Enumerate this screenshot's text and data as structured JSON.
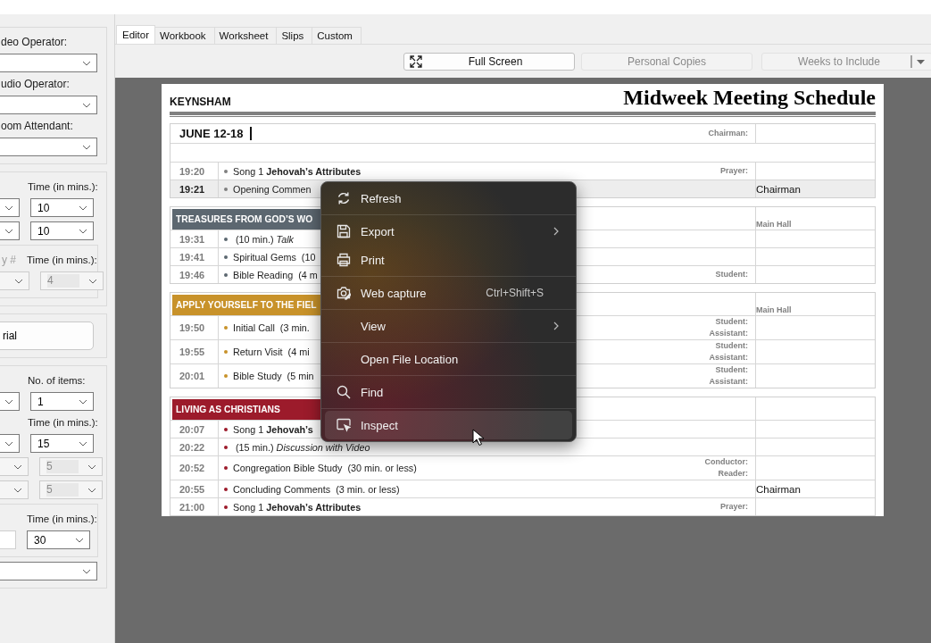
{
  "tabs": [
    {
      "label": "Editor",
      "selected": true
    },
    {
      "label": "Workbook",
      "selected": false
    },
    {
      "label": "Worksheet",
      "selected": false
    },
    {
      "label": "Slips",
      "selected": false
    },
    {
      "label": "Custom",
      "selected": false
    }
  ],
  "toolbar": [
    {
      "label": "Full Screen",
      "kind": "fullscreen",
      "disabled": false
    },
    {
      "label": "Personal Copies",
      "kind": "plain",
      "disabled": true
    },
    {
      "label": "Weeks to Include",
      "kind": "dropdown",
      "disabled": true
    }
  ],
  "side_panel": {
    "groups": [
      {
        "rows": [
          {
            "full": {
              "kind": "label",
              "text": "deo Operator:"
            }
          },
          {
            "full": {
              "kind": "combo",
              "disabled": false
            }
          },
          {
            "full": {
              "kind": "label",
              "text": "udio Operator:"
            }
          },
          {
            "full": {
              "kind": "combo",
              "disabled": false
            }
          },
          {
            "full": {
              "kind": "label",
              "text": "oom Attendant:"
            }
          },
          {
            "full": {
              "kind": "combo",
              "disabled": false
            }
          }
        ]
      },
      {
        "rows": [
          {
            "right": {
              "kind": "label",
              "text": "Time (in mins.):"
            }
          },
          {
            "left": {
              "kind": "combo",
              "disabled": false
            },
            "right": {
              "kind": "combo",
              "value": "10",
              "disabled": false
            }
          },
          {
            "left": {
              "kind": "combo",
              "disabled": false
            },
            "right": {
              "kind": "combo",
              "value": "10",
              "disabled": false
            }
          },
          {
            "kind": "subgroup",
            "rows": [
              {
                "left": {
                  "kind": "label",
                  "text": "y #",
                  "disabled": true
                },
                "right": {
                  "kind": "label",
                  "text": "Time (in mins.):"
                }
              },
              {
                "left": {
                  "kind": "combo",
                  "disabled": true
                },
                "right": {
                  "kind": "combo",
                  "value": "4",
                  "disabled": true
                }
              }
            ]
          }
        ]
      },
      {
        "rows": [
          {
            "full": {
              "kind": "button",
              "text": "rial"
            }
          }
        ]
      },
      {
        "rows": [
          {
            "right": {
              "kind": "label",
              "text": "No. of items:"
            }
          },
          {
            "left": {
              "kind": "combo",
              "disabled": false
            },
            "right": {
              "kind": "combo",
              "value": "1",
              "disabled": false
            }
          },
          {
            "right": {
              "kind": "label",
              "text": "Time (in mins.):"
            }
          },
          {
            "left": {
              "kind": "combo",
              "disabled": false
            },
            "right": {
              "kind": "combo",
              "value": "15",
              "disabled": false
            }
          },
          {
            "left": {
              "kind": "combo",
              "disabled": true
            },
            "right": {
              "kind": "combo",
              "value": "5",
              "disabled": true
            }
          },
          {
            "left": {
              "kind": "combo",
              "disabled": true
            },
            "right": {
              "kind": "combo",
              "value": "5",
              "disabled": true
            }
          },
          {
            "kind": "subgroup",
            "rows": [
              {
                "right": {
                  "kind": "label",
                  "text": "Time (in mins.):"
                }
              },
              {
                "left": {
                  "kind": "input"
                },
                "right": {
                  "kind": "combo",
                  "value": "30",
                  "disabled": false
                }
              }
            ]
          },
          {
            "full": {
              "kind": "combo",
              "disabled": false
            }
          }
        ]
      }
    ]
  },
  "document": {
    "congregation": "KEYNSHAM",
    "title": "Midweek Meeting Schedule",
    "blocks": [
      {
        "color": "#808080",
        "rows": [
          {
            "kind": "week",
            "text": "JUNE 12-18",
            "roles": [
              "Chairman:"
            ]
          },
          {
            "kind": "blank"
          },
          {
            "kind": "item",
            "time": "19:20",
            "text": "Song 1 **Jehovah’s Attributes**",
            "roles": [
              "Prayer:"
            ],
            "selected": false
          },
          {
            "kind": "item",
            "time": "19:21",
            "text": "Opening Commen",
            "assignee": "Chairman",
            "selected": true
          }
        ]
      },
      {
        "color": "#5c6770",
        "header": {
          "title": "TREASURES FROM GOD’S WO",
          "hall": "Main Hall"
        },
        "rows": [
          {
            "kind": "item",
            "time": "19:31",
            "text": " (10 min.) *Talk*",
            "selected": false
          },
          {
            "kind": "item",
            "time": "19:41",
            "text": "Spiritual Gems  (10",
            "selected": false
          },
          {
            "kind": "item",
            "time": "19:46",
            "text": "Bible Reading  (4 m",
            "roles": [
              "Student:"
            ],
            "selected": false
          }
        ]
      },
      {
        "color": "#c8922a",
        "header": {
          "title": "APPLY YOURSELF TO THE FIEL",
          "hall": "Main Hall"
        },
        "rows": [
          {
            "kind": "item",
            "time": "19:50",
            "text": "Initial Call  (3 min.",
            "roles": [
              "Student:",
              "Assistant:"
            ],
            "selected": false
          },
          {
            "kind": "item",
            "time": "19:55",
            "text": "Return Visit  (4 mi",
            "roles": [
              "Student:",
              "Assistant:"
            ],
            "selected": false
          },
          {
            "kind": "item",
            "time": "20:01",
            "text": "Bible Study  (5 min",
            "roles": [
              "Student:",
              "Assistant:"
            ],
            "selected": false
          }
        ]
      },
      {
        "color": "#9c1b2b",
        "header": {
          "title": "LIVING AS CHRISTIANS"
        },
        "rows": [
          {
            "kind": "item",
            "time": "20:07",
            "text": "Song 1 **Jehovah’s**",
            "selected": false
          },
          {
            "kind": "item",
            "time": "20:22",
            "text": " (15 min.) *Discussion with Video*",
            "selected": false
          },
          {
            "kind": "item",
            "time": "20:52",
            "text": "Congregation Bible Study  (30 min. or less)",
            "roles": [
              "Conductor:",
              "Reader:"
            ],
            "selected": false
          },
          {
            "kind": "item",
            "time": "20:55",
            "text": "Concluding Comments  (3 min. or less)",
            "assignee": "Chairman",
            "selected": false
          },
          {
            "kind": "item",
            "time": "21:00",
            "text": "Song 1 **Jehovah’s Attributes**",
            "roles": [
              "Prayer:"
            ],
            "selected": false
          }
        ]
      }
    ]
  },
  "context_menu": {
    "items": [
      {
        "label": "Refresh",
        "separator_after": true,
        "selected": false
      },
      {
        "label": "Export",
        "submenu": true,
        "selected": false
      },
      {
        "label": "Print",
        "separator_after": true,
        "selected": false
      },
      {
        "label": "Web capture",
        "shortcut": "Ctrl+Shift+S",
        "separator_after": true,
        "selected": false
      },
      {
        "label": "View",
        "submenu": true,
        "separator_after": true,
        "selected": false
      },
      {
        "label": "Open File Location",
        "separator_after": true,
        "selected": false
      },
      {
        "label": "Find",
        "separator_after": true,
        "selected": false
      },
      {
        "label": "Inspect",
        "selected": true
      }
    ]
  }
}
